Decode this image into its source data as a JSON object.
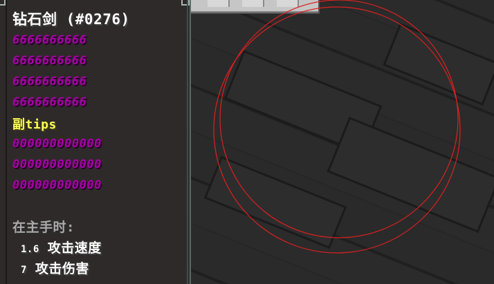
{
  "item": {
    "title": "钻石剑 (#0276)"
  },
  "lore": {
    "lines_6": [
      "6666666666",
      "6666666666",
      "6666666666",
      "6666666666"
    ],
    "sub_label": "副tips",
    "lines_0": [
      "000000000000",
      "000000000000",
      "000000000000"
    ]
  },
  "attributes": {
    "header": "在主手时:",
    "stats": [
      {
        "value": "1.6",
        "label": "攻击速度"
      },
      {
        "value": "7",
        "label": "攻击伤害"
      }
    ]
  },
  "colors": {
    "title": "#ffffff",
    "lore_magenta": "#a800a8",
    "sub_yellow": "#ffff55",
    "attr_gray": "#aaaaaa",
    "circle_red": "#e02020",
    "tooltip_bg": "#2f2a2a"
  }
}
